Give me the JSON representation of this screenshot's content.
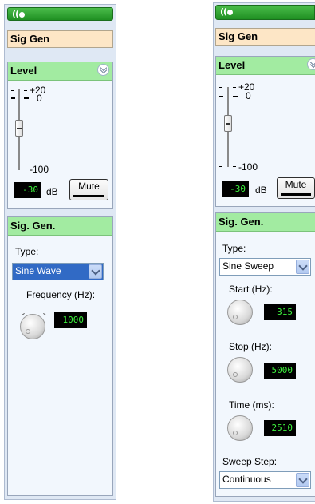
{
  "left": {
    "name": "Sig Gen",
    "level_header": "Level",
    "level_scale": {
      "top": "+20",
      "mid": "0",
      "bottom": "-100"
    },
    "level_value": "-30",
    "level_unit": "dB",
    "mute_label": "Mute",
    "siggen_header": "Sig. Gen.",
    "type_label": "Type:",
    "type_value": "Sine Wave",
    "freq_label": "Frequency (Hz):",
    "freq_value": "1000"
  },
  "right": {
    "name": "Sig Gen",
    "level_header": "Level",
    "level_scale": {
      "top": "+20",
      "mid": "0",
      "bottom": "-100"
    },
    "level_value": "-30",
    "level_unit": "dB",
    "mute_label": "Mute",
    "siggen_header": "Sig. Gen.",
    "type_label": "Type:",
    "type_value": "Sine Sweep",
    "start_label": "Start (Hz):",
    "start_value": "315",
    "stop_label": "Stop (Hz):",
    "stop_value": "5000",
    "time_label": "Time (ms):",
    "time_value": "2510",
    "step_label": "Sweep Step:",
    "step_value": "Continuous"
  },
  "colors": {
    "titlebar": "#2aa52c",
    "section_header": "#a2eba1",
    "name_bar": "#fde6c6",
    "lcd_text": "#3df03d",
    "selected": "#316ac5"
  },
  "icons": [
    "broadcast-icon",
    "chevron-down-icon",
    "dropdown-arrow-icon",
    "knob-icon"
  ]
}
